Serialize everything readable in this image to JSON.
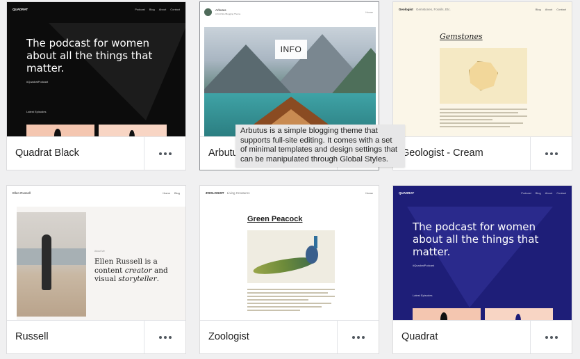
{
  "themes": [
    {
      "name": "Quadrat Black",
      "preview": {
        "logo": "QUADRAT",
        "nav": [
          "Podcast",
          "Blog",
          "About",
          "Contact"
        ],
        "headline": "The podcast for women about all the things that matter.",
        "tag": "#QuadratPodcast",
        "section_label": "Latest Episodes"
      }
    },
    {
      "name": "Arbutus",
      "preview": {
        "site_title": "Arbutus",
        "site_tagline": "A Full-Site Blogging Theme",
        "nav": [
          "Home"
        ]
      },
      "info_button": "INFO",
      "tooltip": "Arbutus is a simple blogging theme that supports full-site editing. It comes with a set of minimal templates and design settings that can be manipulated through Global Styles."
    },
    {
      "name": "Geologist - Cream",
      "preview": {
        "logo": "Geologist",
        "tagline": "Gemstones, Fossils, Etc.",
        "nav": [
          "Blog",
          "About",
          "Contact"
        ],
        "heading": "Gemstones"
      }
    },
    {
      "name": "Russell",
      "preview": {
        "logo": "Ellen Russell",
        "nav": [
          "Home",
          "Blog"
        ],
        "small_label": "About Me",
        "intro_plain_1": "Ellen Russell is a content ",
        "intro_em_1": "creator",
        "intro_plain_2": " and visual ",
        "intro_em_2": "storyteller",
        "intro_plain_3": "."
      }
    },
    {
      "name": "Zoologist",
      "preview": {
        "logo": "ZOOLOGIST",
        "tagline": "Living Creatures",
        "nav": [
          "Home"
        ],
        "heading": "Green Peacock"
      }
    },
    {
      "name": "Quadrat",
      "preview": {
        "logo": "QUADRAT",
        "nav": [
          "Podcast",
          "Blog",
          "About",
          "Contact"
        ],
        "headline": "The podcast for women about all the things that matter.",
        "tag": "#QuadratPodcast",
        "section_label": "Latest Episodes"
      }
    }
  ],
  "colors": {
    "quadrat_black_bg": "#0c0c0c",
    "quadrat_blue_bg": "#1e1e78",
    "geologist_bg": "#fbf6e8",
    "tooltip_bg": "#e7e7e8"
  }
}
